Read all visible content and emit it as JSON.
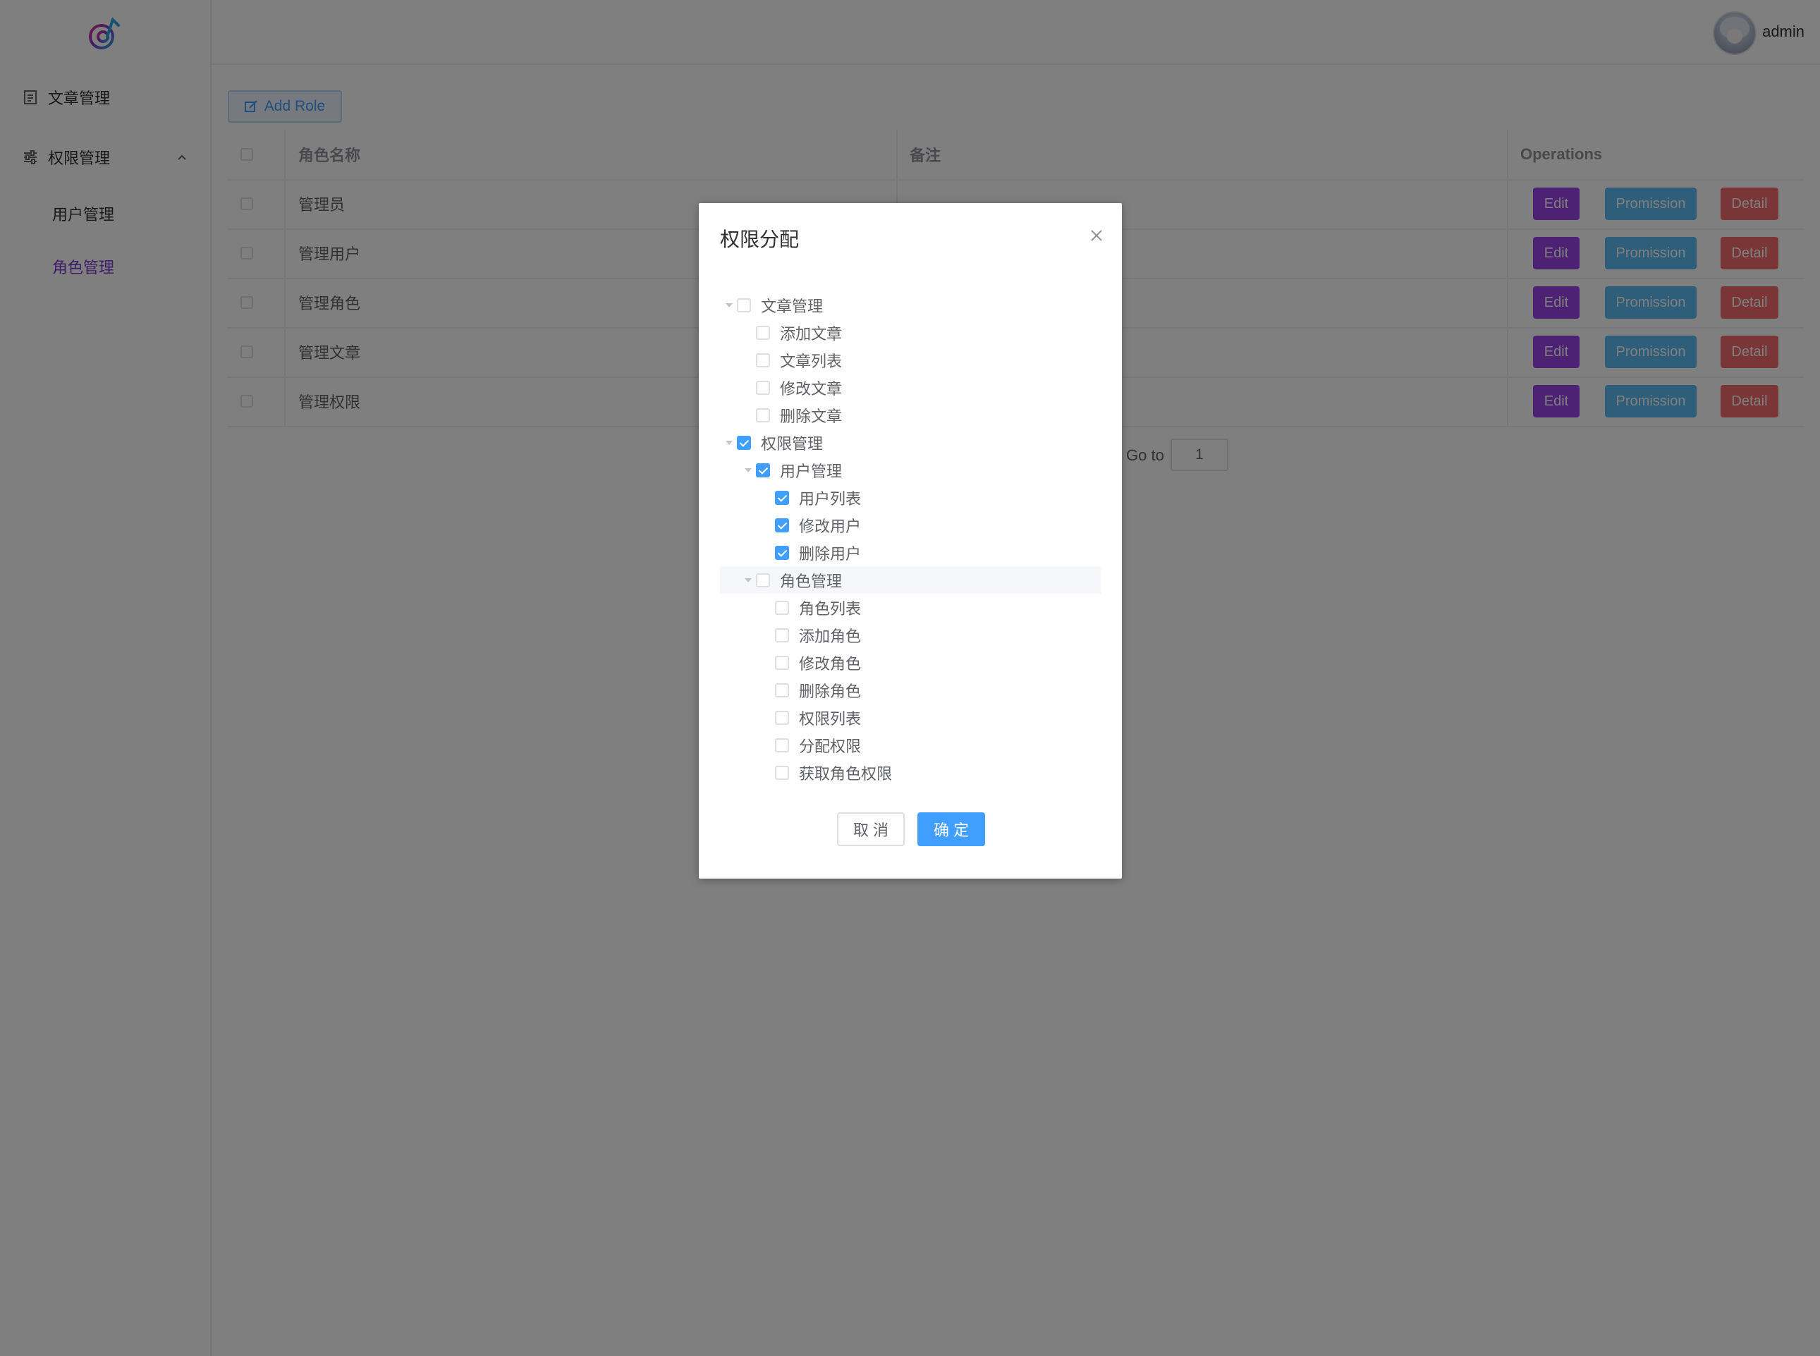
{
  "sidebar": {
    "logo_icon": "app-logo-icon",
    "items": [
      {
        "label": "文章管理",
        "icon": "document-icon"
      },
      {
        "label": "权限管理",
        "icon": "sliders-icon"
      }
    ],
    "submenu": [
      {
        "label": "用户管理"
      },
      {
        "label": "角色管理",
        "active": true
      }
    ]
  },
  "header": {
    "username": "admin"
  },
  "toolbar": {
    "add_role_label": "Add Role"
  },
  "table": {
    "columns": [
      "角色名称",
      "备注",
      "Operations"
    ],
    "rows": [
      {
        "name": "管理员",
        "note": ""
      },
      {
        "name": "管理用户",
        "note": ""
      },
      {
        "name": "管理角色",
        "note": ""
      },
      {
        "name": "管理文章",
        "note": ""
      },
      {
        "name": "管理权限",
        "note": ""
      }
    ],
    "actions": {
      "edit": "Edit",
      "permission": "Promission",
      "detail": "Detail"
    }
  },
  "pagination": {
    "goto_label": "Go to",
    "page": "1"
  },
  "dialog": {
    "title": "权限分配",
    "tree": [
      {
        "label": "文章管理",
        "checked": false,
        "expandable": true
      },
      {
        "label": "添加文章",
        "checked": false
      },
      {
        "label": "文章列表",
        "checked": false
      },
      {
        "label": "修改文章",
        "checked": false
      },
      {
        "label": "删除文章",
        "checked": false
      },
      {
        "label": "权限管理",
        "checked": true,
        "expandable": true
      },
      {
        "label": "用户管理",
        "checked": true,
        "expandable": true
      },
      {
        "label": "用户列表",
        "checked": true
      },
      {
        "label": "修改用户",
        "checked": true
      },
      {
        "label": "删除用户",
        "checked": true
      },
      {
        "label": "角色管理",
        "checked": false,
        "expandable": true,
        "highlighted": true
      },
      {
        "label": "角色列表",
        "checked": false
      },
      {
        "label": "添加角色",
        "checked": false
      },
      {
        "label": "修改角色",
        "checked": false
      },
      {
        "label": "删除角色",
        "checked": false
      },
      {
        "label": "权限列表",
        "checked": false
      },
      {
        "label": "分配权限",
        "checked": false
      },
      {
        "label": "获取角色权限",
        "checked": false
      }
    ],
    "cancel_label": "取 消",
    "confirm_label": "确 定"
  },
  "colors": {
    "primary": "#409eff",
    "edit": "#9b43e6",
    "permission": "#5dbcf3",
    "detail": "#f56c6c",
    "active_menu": "#7b3bd1"
  }
}
